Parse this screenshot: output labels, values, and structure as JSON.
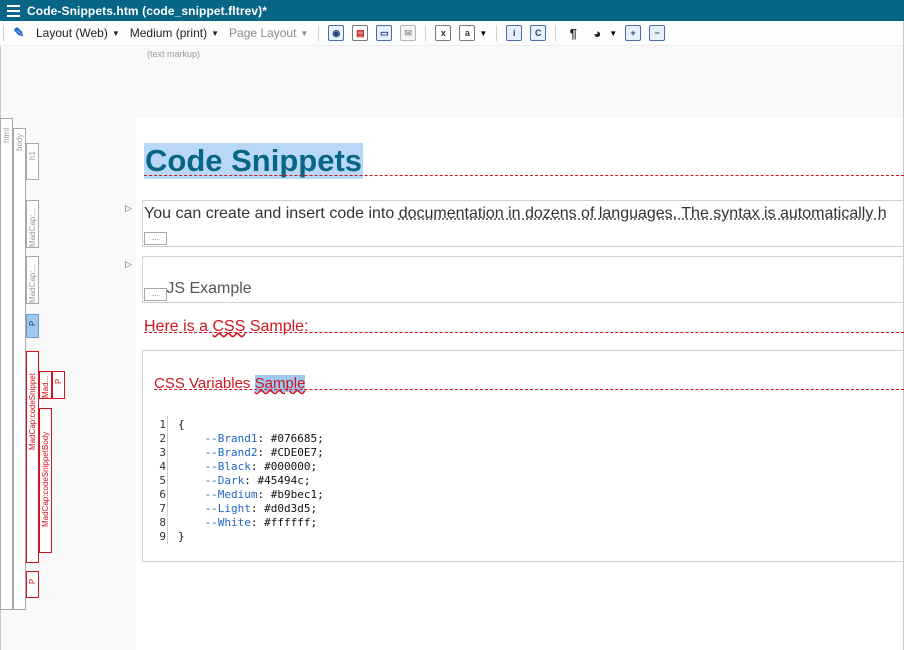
{
  "window": {
    "title": "Code-Snippets.htm (code_snippet.fltrev)*"
  },
  "toolbar": {
    "layout_label": "Layout (Web)",
    "medium_label": "Medium (print)",
    "page_layout_label": "Page Layout",
    "icons": [
      "cursor-pick-icon",
      "web-preview-icon",
      "print-preview-icon",
      "image-icon",
      "disabled-icon",
      "field-icon",
      "text-format-icon",
      "show-tags-icon",
      "conditions-icon",
      "pilcrow-icon",
      "view-options-icon",
      "expand-icon",
      "collapse-icon"
    ],
    "show_tags_text": "i",
    "conditions_text": "C",
    "pilcrow_text": "¶"
  },
  "markup": {
    "label": "(text markup)",
    "tags": {
      "html": "html",
      "body": "body",
      "h1": "h1",
      "madcap1": "MadCap:...",
      "madcap2": "MadCap:...",
      "p1": "P",
      "codesnippet": "MadCap:codeSnippet",
      "mad": "Mad...",
      "p2": "P",
      "codesnippetbody": "MadCap:codeSnippetBody",
      "p3": "P"
    }
  },
  "document": {
    "heading": "Code Snippets",
    "paragraph1_start": "You can create and insert code into ",
    "paragraph1_link": "documentation in dozens of languages. The syntax is automatically h",
    "paragraph2_partial": "...JS Example",
    "ellipsis": "...",
    "css_intro_a": "Here is a ",
    "css_intro_b": "CSS",
    "css_intro_c": " Sample:",
    "snippet_caption_a": "CSS Variables ",
    "snippet_caption_b": "Sample",
    "code_lines": [
      "{",
      "    --Brand1: #076685;",
      "    --Brand2: #CDE0E7;",
      "    --Black: #000000;",
      "    --Dark: #45494c;",
      "    --Medium: #b9bec1;",
      "    --Light: #d0d3d5;",
      "    --White: #ffffff;",
      "}"
    ],
    "code_line_numbers": [
      "1",
      "2",
      "3",
      "4",
      "5",
      "6",
      "7",
      "8",
      "9"
    ]
  },
  "colors": {
    "brand": "#076685",
    "highlight": "#b9d8f7",
    "error": "#d0151f",
    "selection": "#9fc8f0"
  }
}
